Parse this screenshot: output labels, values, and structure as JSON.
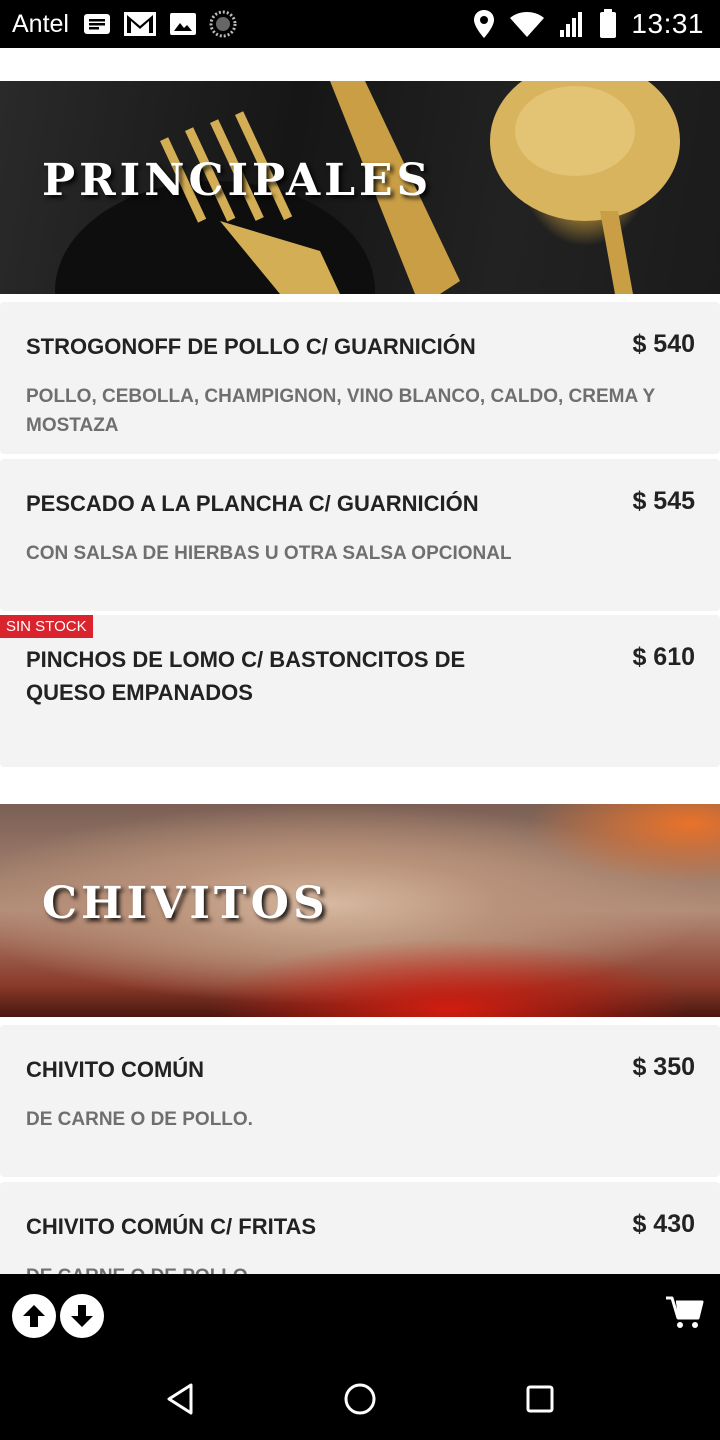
{
  "status_bar": {
    "carrier": "Antel",
    "time": "13:31"
  },
  "sections": [
    {
      "title": "PRINCIPALES",
      "items": [
        {
          "name": "STROGONOFF DE POLLO C/ GUARNICIÓN",
          "price": "$ 540",
          "description": "POLLO, CEBOLLA, CHAMPIGNON, VINO BLANCO, CALDO, CREMA Y MOSTAZA"
        },
        {
          "name": "PESCADO A LA PLANCHA C/ GUARNICIÓN",
          "price": "$ 545",
          "description": "CON SALSA DE HIERBAS U OTRA SALSA OPCIONAL"
        },
        {
          "name": "PINCHOS DE LOMO C/ BASTONCITOS DE QUESO EMPANADOS",
          "price": "$ 610",
          "description": "",
          "badge": "SIN STOCK"
        }
      ]
    },
    {
      "title": "CHIVITOS",
      "items": [
        {
          "name": "CHIVITO COMÚN",
          "price": "$ 350",
          "description": "DE CARNE O DE POLLO."
        },
        {
          "name": "CHIVITO COMÚN C/ FRITAS",
          "price": "$ 430",
          "description": "DE CARNE O DE POLLO."
        }
      ]
    }
  ],
  "colors": {
    "badge": "#d9232d",
    "card_bg": "#f3f3f3",
    "bar_bg": "#000000"
  }
}
